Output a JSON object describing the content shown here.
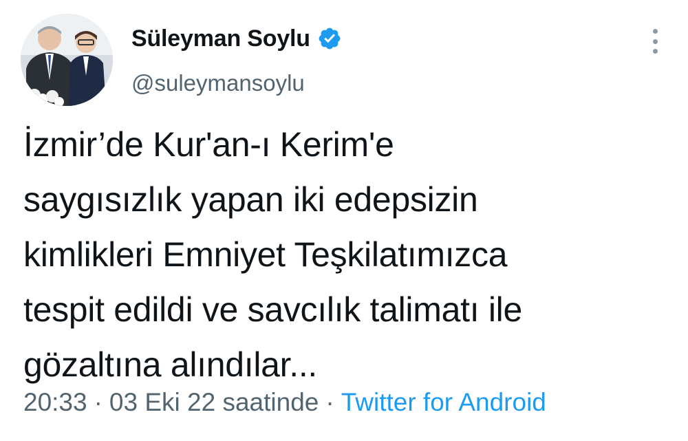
{
  "author": {
    "display_name": "Süleyman Soylu",
    "handle": "@suleymansoylu",
    "verified_icon": "verified-badge-icon",
    "avatar_icon": "profile-photo"
  },
  "tweet": {
    "text": "İzmir’de Kur'an-ı Kerim'e\nsaygısızlık yapan iki edepsizin\nkimlikleri Emniyet Teşkilatımızca\ntespit edildi ve savcılık talimatı ile\ngözaltına alındılar..."
  },
  "meta": {
    "time": "20:33",
    "separator_1": "·",
    "date": "03 Eki 22 saatinde",
    "separator_2": "·",
    "source": "Twitter for Android"
  },
  "colors": {
    "accent": "#1d9bf0",
    "text": "#0f1419",
    "secondary": "#536471"
  },
  "menu": {
    "more_icon": "more-vertical-icon"
  }
}
